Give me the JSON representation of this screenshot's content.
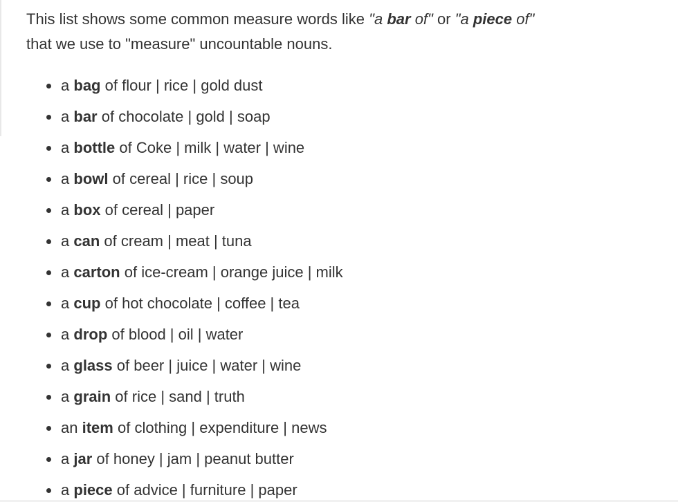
{
  "intro": {
    "text_before": "This list shows some common measure words like ",
    "example1_article": "\"a ",
    "example1_word": "bar",
    "example1_rest": " of\"",
    "or": " or ",
    "example2_article": "\"a ",
    "example2_word": "piece",
    "example2_rest": " of\"",
    "line2": "that we use to \"measure\" uncountable nouns."
  },
  "items": [
    {
      "article": "a",
      "word": "bag",
      "rest": "of flour | rice | gold dust"
    },
    {
      "article": "a",
      "word": "bar",
      "rest": "of chocolate | gold | soap"
    },
    {
      "article": "a",
      "word": "bottle",
      "rest": "of Coke | milk | water | wine"
    },
    {
      "article": "a",
      "word": "bowl",
      "rest": "of cereal | rice | soup"
    },
    {
      "article": "a",
      "word": "box",
      "rest": "of cereal | paper"
    },
    {
      "article": "a",
      "word": "can",
      "rest": "of cream | meat | tuna"
    },
    {
      "article": "a",
      "word": "carton",
      "rest": "of ice-cream | orange juice | milk"
    },
    {
      "article": "a",
      "word": "cup",
      "rest": "of hot chocolate | coffee | tea"
    },
    {
      "article": "a",
      "word": "drop",
      "rest": "of blood | oil | water"
    },
    {
      "article": "a",
      "word": "glass",
      "rest": "of beer | juice | water | wine"
    },
    {
      "article": "a",
      "word": "grain",
      "rest": "of rice | sand | truth"
    },
    {
      "article": "an",
      "word": "item",
      "rest": "of clothing | expenditure | news"
    },
    {
      "article": "a",
      "word": "jar",
      "rest": "of honey | jam | peanut butter"
    },
    {
      "article": "a",
      "word": "piece",
      "rest": "of advice | furniture | paper"
    }
  ]
}
